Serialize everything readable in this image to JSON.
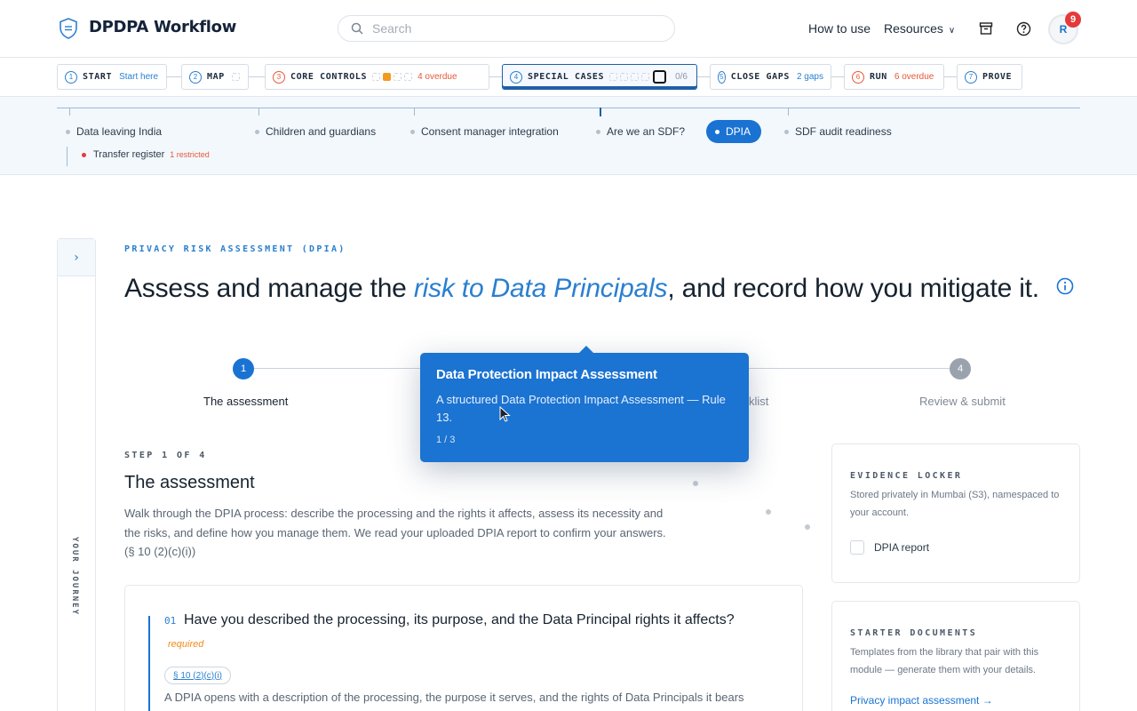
{
  "header": {
    "app_title": "DPDPA Workflow",
    "search_placeholder": "Search",
    "how_to_use": "How to use",
    "resources": "Resources",
    "avatar_initial": "R",
    "notification_count": "9"
  },
  "tabs": [
    {
      "num": "1",
      "label": "START",
      "sub": "Start here"
    },
    {
      "num": "2",
      "label": "MAP",
      "sub": ""
    },
    {
      "num": "3",
      "label": "CORE CONTROLS",
      "sub": "4 overdue"
    },
    {
      "num": "4",
      "label": "SPECIAL CASES",
      "sub": "0/6"
    },
    {
      "num": "5",
      "label": "CLOSE GAPS",
      "sub": "2 gaps"
    },
    {
      "num": "6",
      "label": "RUN",
      "sub": "6 overdue"
    },
    {
      "num": "7",
      "label": "PROVE",
      "sub": ""
    }
  ],
  "subnav": {
    "items": [
      "Data leaving India",
      "Children and guardians",
      "Consent manager integration",
      "Are we an SDF?",
      "DPIA",
      "SDF audit readiness"
    ],
    "child_item": "Transfer register",
    "child_badge": "1 restricted"
  },
  "journey": {
    "label": "YOUR JOURNEY"
  },
  "main": {
    "eyebrow": "PRIVACY RISK ASSESSMENT (DPIA)",
    "headline_pre": "Assess and manage the ",
    "headline_em": "risk to Data Principals",
    "headline_post": ", and record how you mitigate it.",
    "progress": {
      "step1": "1",
      "step4": "4",
      "label1": "The assessment",
      "label3": "klist",
      "label4": "Review & submit"
    },
    "step_of": "STEP 1 OF 4",
    "step_title": "The assessment",
    "step_desc": "Walk through the DPIA process: describe the processing and the rights it affects, assess its necessity and the risks, and define how you manage them. We read your uploaded DPIA report to confirm your answers. (§ 10 (2)(c)(i))",
    "question": {
      "num": "01",
      "text": "Have you described the processing, its purpose, and the Data Principal rights it affects?",
      "required": "required",
      "ref": "§ 10 (2)(c)(i)",
      "body": "A DPIA opens with a description of the processing, the purpose it serves, and the rights of Data Principals it bears"
    }
  },
  "evidence": {
    "title": "EVIDENCE LOCKER",
    "desc": "Stored privately in Mumbai (S3), namespaced to your account.",
    "item": "DPIA report"
  },
  "starter": {
    "title": "STARTER DOCUMENTS",
    "desc": "Templates from the library that pair with this module — generate them with your details.",
    "link": "Privacy impact assessment →"
  },
  "tooltip": {
    "title": "Data Protection Impact Assessment",
    "body": "A structured Data Protection Impact Assessment — Rule 13.",
    "count": "1 / 3"
  },
  "colors": {
    "accent": "#1a73d2",
    "warning": "#e45a3a",
    "orange": "#f39a1f"
  }
}
